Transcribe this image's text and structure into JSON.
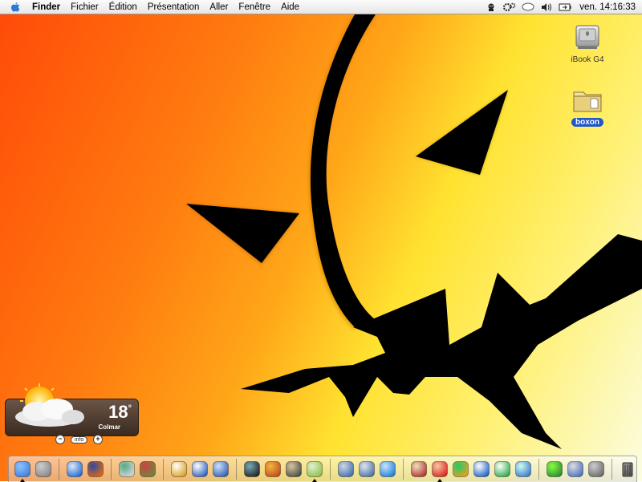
{
  "menubar": {
    "app": "Finder",
    "items": [
      "Fichier",
      "Édition",
      "Présentation",
      "Aller",
      "Fenêtre",
      "Aide"
    ],
    "clock": "ven. 14:16:33",
    "status_icons": [
      "robot-icon",
      "gears-icon",
      "speech-bubble-icon",
      "volume-icon",
      "battery-icon"
    ]
  },
  "desktop_icons": [
    {
      "label": "iBook G4",
      "icon": "hard-drive-icon",
      "selected": false
    },
    {
      "label": "boxon",
      "icon": "folder-icon",
      "selected": true
    }
  ],
  "weather": {
    "temperature": "18",
    "degree": "°",
    "city": "Colmar",
    "minus": "−",
    "info": "info",
    "plus": "+"
  },
  "dock": {
    "groups": [
      [
        "finder-icon",
        "system-preferences-icon"
      ],
      [
        "safari-icon",
        "firefox-icon"
      ],
      [
        "preview-icon",
        "stuffit-icon"
      ],
      [
        "font-book-icon",
        "textedit-icon",
        "word-icon"
      ],
      [
        "imovie-icon",
        "garageband-icon",
        "iphoto-icon",
        "itunes-icon"
      ],
      [
        "iphoto-library-icon",
        "network-icon",
        "quicktime-icon"
      ],
      [
        "address-book-icon",
        "character-icon",
        "adium-icon",
        "s-icon",
        "skype-icon",
        "ichat-icon"
      ],
      [
        "activity-monitor-icon",
        "script-icon",
        "grapher-icon"
      ],
      [
        "trash-icon"
      ]
    ]
  }
}
